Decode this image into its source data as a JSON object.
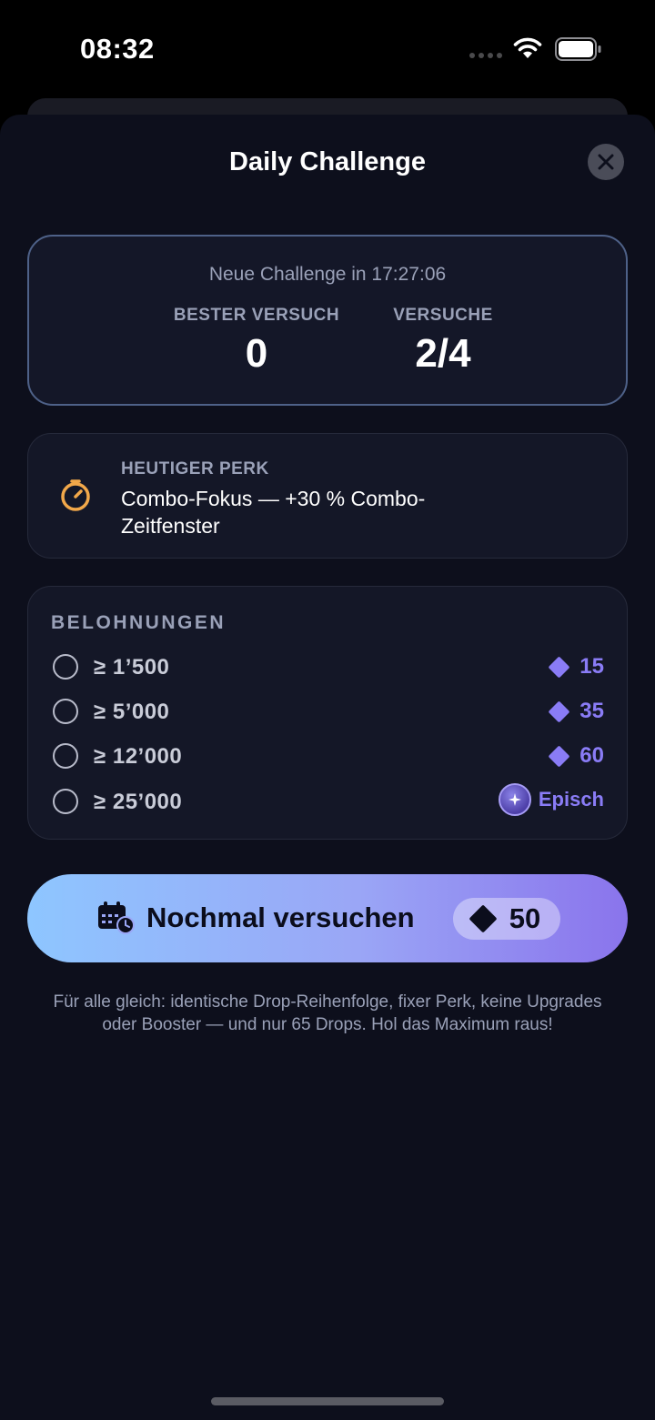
{
  "status_bar": {
    "time": "08:32"
  },
  "sheet": {
    "title": "Daily Challenge"
  },
  "stats": {
    "countdown": "Neue Challenge in 17:27:06",
    "best_label": "BESTER VERSUCH",
    "best_value": "0",
    "tries_label": "VERSUCHE",
    "tries_value": "2/4"
  },
  "perk": {
    "label": "HEUTIGER PERK",
    "text": "Combo-Fokus — +30 % Combo-Zeitfenster",
    "icon": "timer-icon"
  },
  "rewards": {
    "title": "BELOHNUNGEN",
    "items": [
      {
        "threshold": "≥ 1’500",
        "reward": "15",
        "icon": "diamond-icon"
      },
      {
        "threshold": "≥ 5’000",
        "reward": "35",
        "icon": "diamond-icon"
      },
      {
        "threshold": "≥ 12’000",
        "reward": "60",
        "icon": "diamond-icon"
      },
      {
        "threshold": "≥ 25’000",
        "reward": "Episch",
        "icon": "epic-orb-icon"
      }
    ]
  },
  "retry_button": {
    "label": "Nochmal versuchen",
    "cost": "50",
    "icon": "calendar-icon"
  },
  "footnote": "Für alle gleich: identische Drop-Reihenfolge, fixer Perk, keine Upgrades oder Booster — und nur 65 Drops. Hol das Maximum raus!",
  "colors": {
    "sheet_bg": "#0d0f1c",
    "card_border_accent": "#4e6188",
    "reward_accent": "#8a7cf6",
    "perk_icon": "#f2a84a",
    "button_gradient_start": "#8ec6ff",
    "button_gradient_end": "#8a74ec"
  }
}
